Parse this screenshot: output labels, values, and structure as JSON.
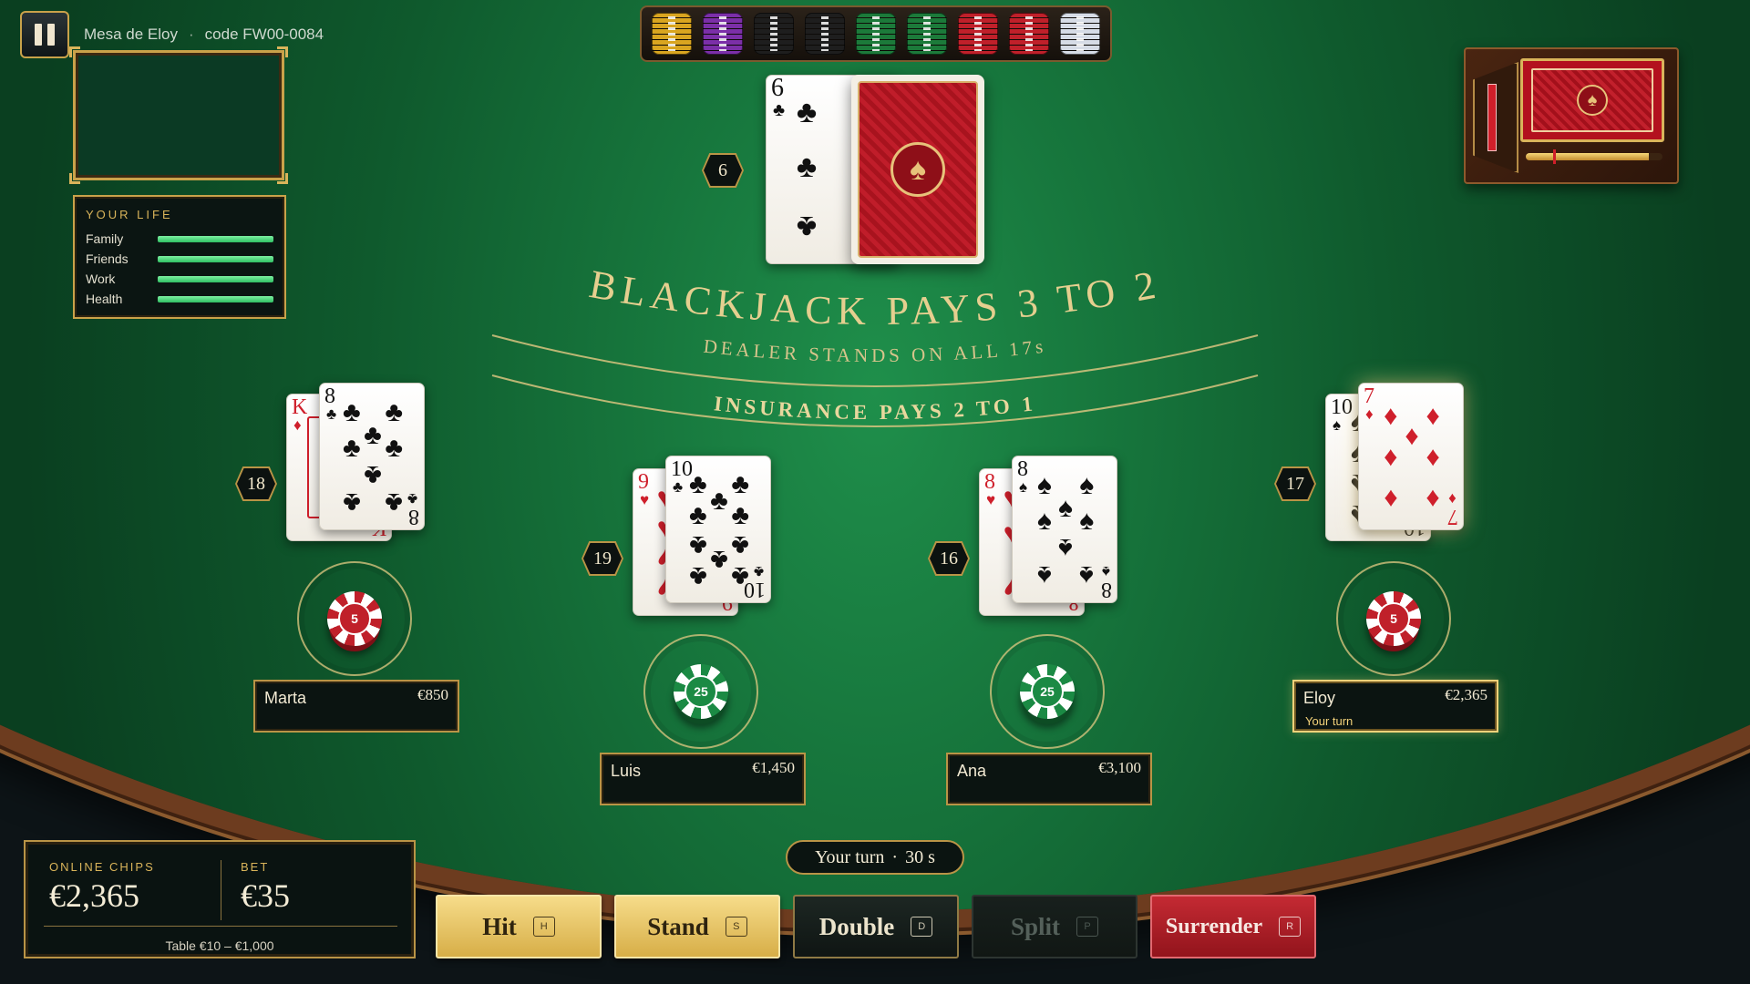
{
  "header": {
    "table_name": "Mesa de Eloy",
    "separator": "·",
    "table_code": "code FW00-0084"
  },
  "life_panel": {
    "title": "YOUR LIFE",
    "meters": [
      {
        "label": "Family",
        "level": 1.0
      },
      {
        "label": "Friends",
        "level": 1.0
      },
      {
        "label": "Work",
        "level": 1.0
      },
      {
        "label": "Health",
        "level": 1.0
      }
    ]
  },
  "chip_tray": {
    "stack_colors": [
      "#d9a520",
      "#7b2fa8",
      "#1e1e1e",
      "#1e1e1e",
      "#1c7a3a",
      "#1c7a3a",
      "#c0202a",
      "#c0202a",
      "#d6dce6"
    ]
  },
  "shoe": {
    "remaining_level": 0.9,
    "cut_card_position": 0.2
  },
  "felt": {
    "headline": "BLACKJACK PAYS 3 TO 2",
    "rule_line": "DEALER STANDS ON ALL 17s",
    "insurance_line": "INSURANCE PAYS 2 TO 1"
  },
  "dealer": {
    "total": "6",
    "up_card": {
      "rank": "6",
      "suit": "♣"
    }
  },
  "seats": [
    {
      "name": "Marta",
      "balance": "€850",
      "total": "18",
      "chip": "5",
      "chip_color": "#c0202a",
      "chip_dark": "#7d0f16",
      "cards": [
        {
          "rank": "K",
          "suit": "♦"
        },
        {
          "rank": "8",
          "suit": "♣"
        }
      ]
    },
    {
      "name": "Luis",
      "balance": "€1,450",
      "total": "19",
      "chip": "25",
      "chip_color": "#1b8a44",
      "chip_dark": "#0d4c24",
      "cards": [
        {
          "rank": "9",
          "suit": "♥"
        },
        {
          "rank": "10",
          "suit": "♣"
        }
      ]
    },
    {
      "name": "Ana",
      "balance": "€3,100",
      "total": "16",
      "chip": "25",
      "chip_color": "#1b8a44",
      "chip_dark": "#0d4c24",
      "cards": [
        {
          "rank": "8",
          "suit": "♥"
        },
        {
          "rank": "8",
          "suit": "♠"
        }
      ]
    },
    {
      "name": "Eloy",
      "balance": "€2,365",
      "total": "17",
      "chip": "5",
      "chip_color": "#c0202a",
      "chip_dark": "#7d0f16",
      "status": "Your turn",
      "cards": [
        {
          "rank": "10",
          "suit": "♠"
        },
        {
          "rank": "7",
          "suit": "♦"
        }
      ]
    }
  ],
  "bankroll": {
    "chips_label": "ONLINE CHIPS",
    "chips_value": "€2,365",
    "bet_label": "BET",
    "bet_value": "€35",
    "limits": "Table €10 – €1,000"
  },
  "turn_timer": {
    "label": "Your turn",
    "separator": "·",
    "seconds": "30 s"
  },
  "actions": [
    {
      "label": "Hit",
      "key": "H",
      "state": "gold"
    },
    {
      "label": "Stand",
      "key": "S",
      "state": "gold"
    },
    {
      "label": "Double",
      "key": "D",
      "state": "dark"
    },
    {
      "label": "Split",
      "key": "P",
      "state": "disabled"
    },
    {
      "label": "Surrender",
      "key": "R",
      "state": "red"
    }
  ],
  "colors": {
    "felt": "#17773d",
    "gold": "#c9a24a",
    "rail": "#6d3c1f",
    "card_red": "#cf1f2b"
  },
  "icons": {
    "pause": "pause-icon",
    "back_emblem": "spade-emblem-icon"
  }
}
